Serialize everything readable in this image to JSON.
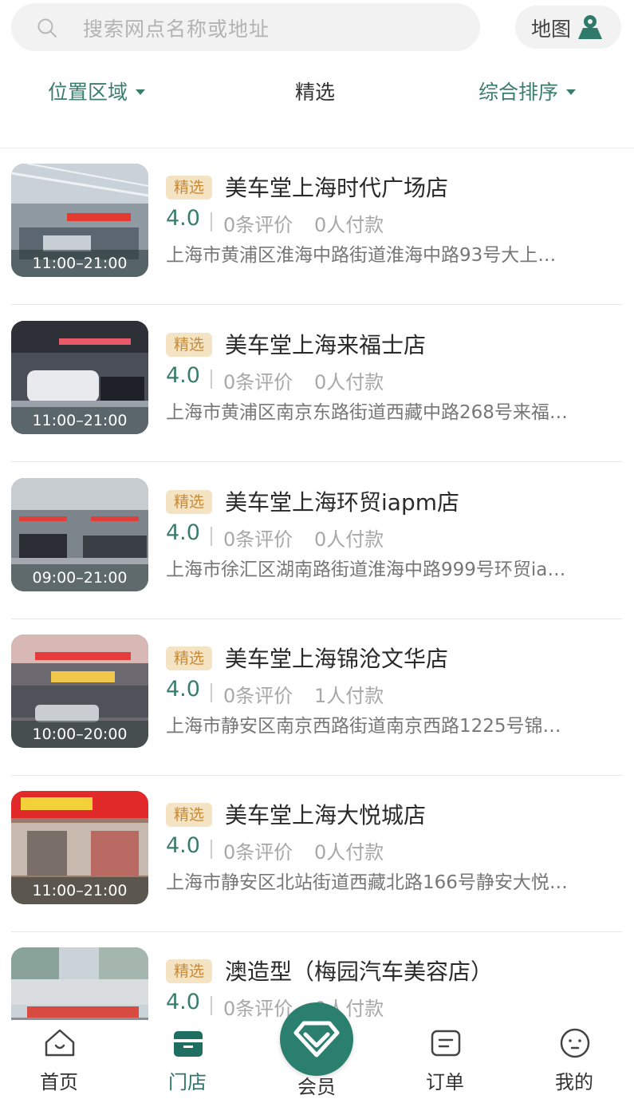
{
  "search": {
    "placeholder": "搜索网点名称或地址"
  },
  "map_button": {
    "label": "地图"
  },
  "filters": {
    "location": "位置区域",
    "featured": "精选",
    "sort": "综合排序"
  },
  "stores": [
    {
      "tag": "精选",
      "name": "美车堂上海时代广场店",
      "rating": "4.0",
      "reviews": "0条评价",
      "paid": "0人付款",
      "address": "上海市黄浦区淮海中路街道淮海中路93号大上…",
      "hours": "11:00–21:00"
    },
    {
      "tag": "精选",
      "name": "美车堂上海来福士店",
      "rating": "4.0",
      "reviews": "0条评价",
      "paid": "0人付款",
      "address": "上海市黄浦区南京东路街道西藏中路268号来福…",
      "hours": "11:00–21:00"
    },
    {
      "tag": "精选",
      "name": "美车堂上海环贸iapm店",
      "rating": "4.0",
      "reviews": "0条评价",
      "paid": "0人付款",
      "address": "上海市徐汇区湖南路街道淮海中路999号环贸ia…",
      "hours": "09:00–21:00"
    },
    {
      "tag": "精选",
      "name": "美车堂上海锦沧文华店",
      "rating": "4.0",
      "reviews": "0条评价",
      "paid": "1人付款",
      "address": "上海市静安区南京西路街道南京西路1225号锦…",
      "hours": "10:00–20:00"
    },
    {
      "tag": "精选",
      "name": "美车堂上海大悦城店",
      "rating": "4.0",
      "reviews": "0条评价",
      "paid": "0人付款",
      "address": "上海市静安区北站街道西藏北路166号静安大悦…",
      "hours": "11:00–21:00"
    },
    {
      "tag": "精选",
      "name": "澳造型（梅园汽车美容店）",
      "rating": "4.0",
      "reviews": "0条评价",
      "paid": "0人付款",
      "address": "",
      "hours": ""
    }
  ],
  "tabs": {
    "home": "首页",
    "store": "门店",
    "member": "会员",
    "orders": "订单",
    "mine": "我的"
  },
  "colors": {
    "accent": "#3a7d6c",
    "tag_bg": "#f4e4c4",
    "tag_text": "#c58b3c",
    "member": "#2b7f6e"
  }
}
